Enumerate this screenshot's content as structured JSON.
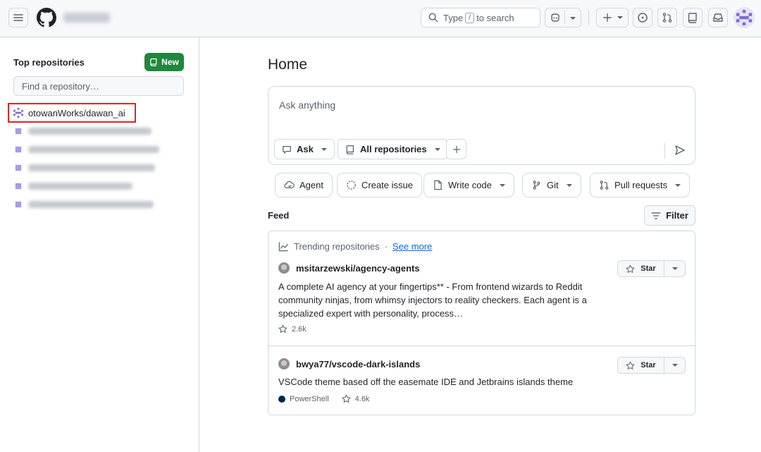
{
  "header": {
    "search_prefix": "Type",
    "search_key": "/",
    "search_suffix": "to search"
  },
  "sidebar": {
    "title": "Top repositories",
    "new_button": "New",
    "find_placeholder": "Find a repository…",
    "repos": [
      {
        "label": "otowanWorks/dawan_ai"
      }
    ]
  },
  "main": {
    "title": "Home",
    "ask": {
      "placeholder": "Ask anything",
      "mode_label": "Ask",
      "scope_label": "All repositories"
    },
    "chips": [
      {
        "label": "Agent"
      },
      {
        "label": "Create issue"
      },
      {
        "label": "Write code"
      },
      {
        "label": "Git"
      },
      {
        "label": "Pull requests"
      }
    ],
    "feed_label": "Feed",
    "filter_label": "Filter",
    "trending": {
      "label": "Trending repositories",
      "separator": "·",
      "see_more": "See more",
      "repos": [
        {
          "name": "msitarzewski/agency-agents",
          "description": "A complete AI agency at your fingertips** - From frontend wizards to Reddit community ninjas, from whimsy injectors to reality checkers. Each agent is a specialized expert with personality, process…",
          "stars": "2.6k",
          "language": "",
          "star_label": "Star"
        },
        {
          "name": "bwya77/vscode-dark-islands",
          "description": "VSCode theme based off the easemate IDE and Jetbrains islands theme",
          "stars": "4.6k",
          "language": "PowerShell",
          "language_color": "#012456",
          "star_label": "Star"
        }
      ]
    }
  },
  "colors": {
    "accent_link": "#0969da",
    "new_button": "#1f883d",
    "highlight": "#e02424"
  }
}
